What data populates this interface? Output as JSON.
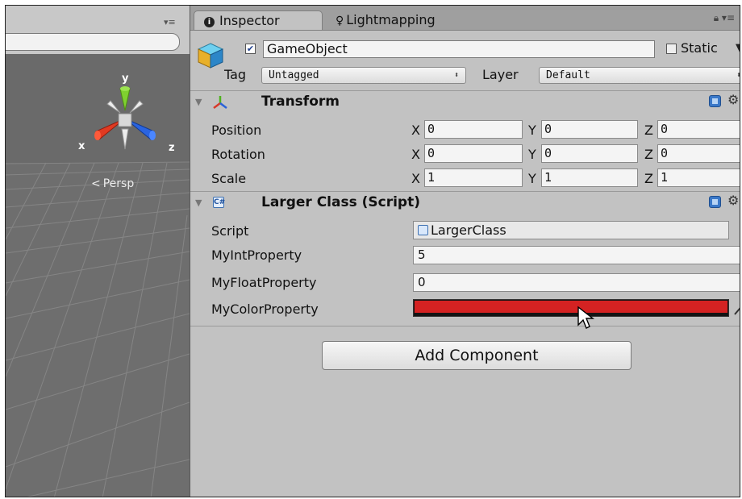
{
  "tabs": {
    "inspector": "Inspector",
    "lightmapping": "Lightmapping"
  },
  "scene": {
    "menu_glyph": "▾≡",
    "gizmo_axes": [
      "y",
      "x",
      "z"
    ],
    "view_mode": "Persp",
    "persp_arrow": "<"
  },
  "game_object": {
    "active": true,
    "name": "GameObject",
    "static_label": "Static",
    "static_checked": false,
    "tag_label": "Tag",
    "tag_value": "Untagged",
    "layer_label": "Layer",
    "layer_value": "Default"
  },
  "transform": {
    "title": "Transform",
    "position_label": "Position",
    "rotation_label": "Rotation",
    "scale_label": "Scale",
    "axis_labels": [
      "X",
      "Y",
      "Z"
    ],
    "position": {
      "x": "0",
      "y": "0",
      "z": "0"
    },
    "rotation": {
      "x": "0",
      "y": "0",
      "z": "0"
    },
    "scale": {
      "x": "1",
      "y": "1",
      "z": "1"
    }
  },
  "script_component": {
    "title": "Larger Class (Script)",
    "script_label": "Script",
    "script_value": "LargerClass",
    "int_label": "MyIntProperty",
    "int_value": "5",
    "float_label": "MyFloatProperty",
    "float_value": "0",
    "color_label": "MyColorProperty",
    "color_value": "#d42222"
  },
  "add_component_label": "Add Component"
}
